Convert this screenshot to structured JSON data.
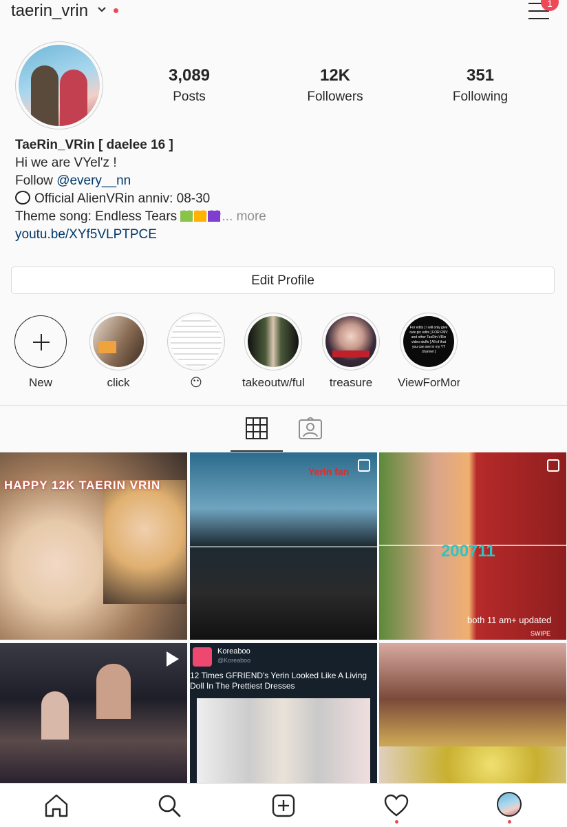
{
  "header": {
    "username": "taerin_vrin",
    "menu_badge": "1"
  },
  "stats": [
    {
      "value": "3,089",
      "label": "Posts"
    },
    {
      "value": "12K",
      "label": "Followers"
    },
    {
      "value": "351",
      "label": "Following"
    }
  ],
  "bio": {
    "name": "TaeRin_VRin [ daelee 16 ]",
    "line1": "Hi we are VYel'z !",
    "follow_prefix": "Follow ",
    "follow_handle": "@every__nn",
    "line3": "Official AlienVRin anniv: 08-30",
    "line4": "Theme song: Endless Tears ",
    "more": "... more",
    "url": "youtu.be/XYf5VLPTPCE"
  },
  "edit_profile_label": "Edit Profile",
  "highlights": [
    {
      "label": "New"
    },
    {
      "label": "click"
    },
    {
      "label": "😶"
    },
    {
      "label": "takeoutw/ful..."
    },
    {
      "label": "treasure"
    },
    {
      "label": "ViewForMor..."
    }
  ],
  "highlight_texts": {
    "viewformore": "For edits [ I will only give rare pic edits ] FOR FMV and other TaeRin-VRin video stuffs [ All of that you can see in my YT channel ]"
  },
  "posts": {
    "p1_text": "HAPPY 12K TAERIN VRIN",
    "p2_text": "Yerin fan",
    "p3_number": "200711",
    "p3_caption": "both 11 am+ updated",
    "p3_swipe": "SWIPE",
    "p5_source": "Koreaboo",
    "p5_handle": "@Koreaboo",
    "p5_headline": "12 Times GFRIEND's Yerin Looked Like A Living Doll In The Prettiest Dresses"
  },
  "colors": {
    "accent_red": "#ed4956",
    "link_blue": "#00376b"
  }
}
